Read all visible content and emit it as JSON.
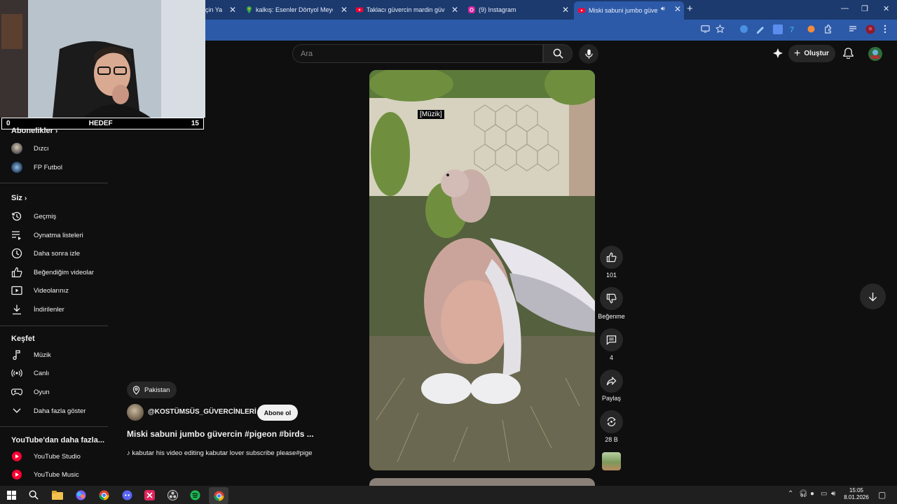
{
  "browser": {
    "tabs": [
      {
        "label": "için Ya",
        "icon": "page-icon",
        "active": false
      },
      {
        "label": "kalkış: Esenler Dörtyol Meydanı",
        "icon": "maps-pin-icon",
        "active": false
      },
      {
        "label": "Taklacı güvercin mardin güvercin",
        "icon": "youtube-icon",
        "active": false
      },
      {
        "label": "(9) Instagram",
        "icon": "instagram-icon",
        "active": false
      },
      {
        "label": "Miski sabuni jumbo güvercin",
        "icon": "youtube-icon",
        "active": true
      }
    ],
    "new_tab": "+",
    "window_controls": {
      "minimize": "—",
      "restore": "❐",
      "close": "✕"
    },
    "colors": {
      "tabbar": "#1c3a6e",
      "toolbar": "#2d5aa8"
    }
  },
  "stream_overlay": {
    "goal_left": "0",
    "goal_label": "HEDEF",
    "goal_right": "15"
  },
  "header": {
    "search_placeholder": "Ara",
    "create_label": "Oluştur"
  },
  "sidebar": {
    "subscriptions_heading": "Abonelikler",
    "subscriptions": [
      {
        "label": "Dızcı"
      },
      {
        "label": "FP Futbol"
      }
    ],
    "you_heading": "Siz",
    "you_items": [
      {
        "label": "Geçmiş",
        "icon": "history-icon"
      },
      {
        "label": "Oynatma listeleri",
        "icon": "playlist-icon"
      },
      {
        "label": "Daha sonra izle",
        "icon": "clock-icon"
      },
      {
        "label": "Beğendiğim videolar",
        "icon": "thumb-up-icon"
      },
      {
        "label": "Videolarınız",
        "icon": "video-icon"
      },
      {
        "label": "İndirilenler",
        "icon": "download-icon"
      }
    ],
    "explore_heading": "Keşfet",
    "explore_items": [
      {
        "label": "Müzik",
        "icon": "music-note-icon"
      },
      {
        "label": "Canlı",
        "icon": "live-icon"
      },
      {
        "label": "Oyun",
        "icon": "gamepad-icon"
      },
      {
        "label": "Daha fazla göster",
        "icon": "chevron-down-icon"
      }
    ],
    "more_heading": "YouTube'dan daha fazla...",
    "more_items": [
      {
        "label": "YouTube Studio"
      },
      {
        "label": "YouTube Music"
      }
    ]
  },
  "video": {
    "caption": "[Müzik]",
    "location": "Pakistan",
    "channel": "@KOSTÜMSÜS_GÜVERCİNLERİ",
    "subscribe_label": "Abone ol",
    "title": "Miski sabuni jumbo güvercin #pigeon #birds ...",
    "music": "kabutar his video editing kabutar lover subscribe please#pige"
  },
  "actions": {
    "likes": "101",
    "dislike_label": "Beğenme",
    "comments": "4",
    "share_label": "Paylaş",
    "remix_count": "28 B"
  },
  "taskbar": {
    "time": "15:05",
    "date": "8.01.2026"
  }
}
